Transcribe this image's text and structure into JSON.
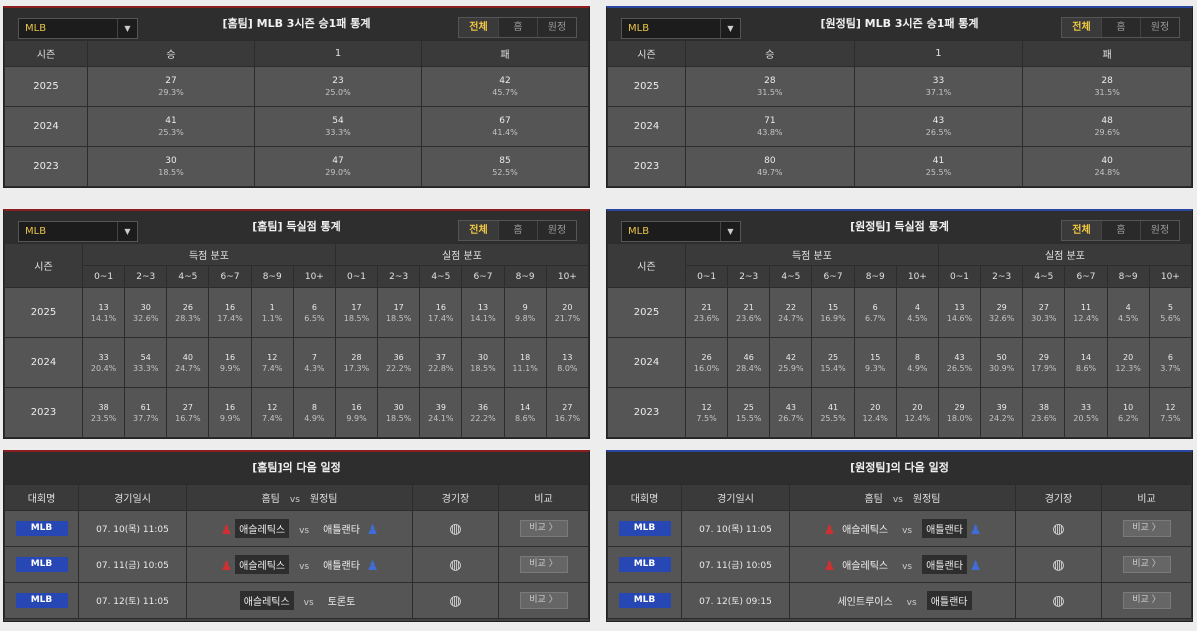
{
  "league_select": "MLB",
  "tabs": [
    "전체",
    "홈",
    "원정"
  ],
  "wdl_headers": [
    "시즌",
    "승",
    "1",
    "패"
  ],
  "home_wdl": {
    "title": "[홈팀] MLB 3시즌 승1패 통계",
    "rows": [
      {
        "season": "2025",
        "w": "27",
        "wp": "29.3%",
        "d": "23",
        "dp": "25.0%",
        "l": "42",
        "lp": "45.7%"
      },
      {
        "season": "2024",
        "w": "41",
        "wp": "25.3%",
        "d": "54",
        "dp": "33.3%",
        "l": "67",
        "lp": "41.4%"
      },
      {
        "season": "2023",
        "w": "30",
        "wp": "18.5%",
        "d": "47",
        "dp": "29.0%",
        "l": "85",
        "lp": "52.5%"
      }
    ]
  },
  "away_wdl": {
    "title": "[원정팀] MLB 3시즌 승1패 통계",
    "rows": [
      {
        "season": "2025",
        "w": "28",
        "wp": "31.5%",
        "d": "33",
        "dp": "37.1%",
        "l": "28",
        "lp": "31.5%"
      },
      {
        "season": "2024",
        "w": "71",
        "wp": "43.8%",
        "d": "43",
        "dp": "26.5%",
        "l": "48",
        "lp": "29.6%"
      },
      {
        "season": "2023",
        "w": "80",
        "wp": "49.7%",
        "d": "41",
        "dp": "25.5%",
        "l": "40",
        "lp": "24.8%"
      }
    ]
  },
  "runs_headers": {
    "season": "시즌",
    "scored": "득점 분포",
    "allowed": "실점 분포",
    "ranges": [
      "0~1",
      "2~3",
      "4~5",
      "6~7",
      "8~9",
      "10+"
    ]
  },
  "home_runs": {
    "title": "[홈팀] 득실점 통계",
    "rows": [
      {
        "season": "2025",
        "cells": [
          [
            "13",
            "14.1%"
          ],
          [
            "30",
            "32.6%"
          ],
          [
            "26",
            "28.3%"
          ],
          [
            "16",
            "17.4%"
          ],
          [
            "1",
            "1.1%"
          ],
          [
            "6",
            "6.5%"
          ],
          [
            "17",
            "18.5%"
          ],
          [
            "17",
            "18.5%"
          ],
          [
            "16",
            "17.4%"
          ],
          [
            "13",
            "14.1%"
          ],
          [
            "9",
            "9.8%"
          ],
          [
            "20",
            "21.7%"
          ]
        ]
      },
      {
        "season": "2024",
        "cells": [
          [
            "33",
            "20.4%"
          ],
          [
            "54",
            "33.3%"
          ],
          [
            "40",
            "24.7%"
          ],
          [
            "16",
            "9.9%"
          ],
          [
            "12",
            "7.4%"
          ],
          [
            "7",
            "4.3%"
          ],
          [
            "28",
            "17.3%"
          ],
          [
            "36",
            "22.2%"
          ],
          [
            "37",
            "22.8%"
          ],
          [
            "30",
            "18.5%"
          ],
          [
            "18",
            "11.1%"
          ],
          [
            "13",
            "8.0%"
          ]
        ]
      },
      {
        "season": "2023",
        "cells": [
          [
            "38",
            "23.5%"
          ],
          [
            "61",
            "37.7%"
          ],
          [
            "27",
            "16.7%"
          ],
          [
            "16",
            "9.9%"
          ],
          [
            "12",
            "7.4%"
          ],
          [
            "8",
            "4.9%"
          ],
          [
            "16",
            "9.9%"
          ],
          [
            "30",
            "18.5%"
          ],
          [
            "39",
            "24.1%"
          ],
          [
            "36",
            "22.2%"
          ],
          [
            "14",
            "8.6%"
          ],
          [
            "27",
            "16.7%"
          ]
        ]
      }
    ]
  },
  "away_runs": {
    "title": "[원정팀] 득실점 통계",
    "rows": [
      {
        "season": "2025",
        "cells": [
          [
            "21",
            "23.6%"
          ],
          [
            "21",
            "23.6%"
          ],
          [
            "22",
            "24.7%"
          ],
          [
            "15",
            "16.9%"
          ],
          [
            "6",
            "6.7%"
          ],
          [
            "4",
            "4.5%"
          ],
          [
            "13",
            "14.6%"
          ],
          [
            "29",
            "32.6%"
          ],
          [
            "27",
            "30.3%"
          ],
          [
            "11",
            "12.4%"
          ],
          [
            "4",
            "4.5%"
          ],
          [
            "5",
            "5.6%"
          ]
        ]
      },
      {
        "season": "2024",
        "cells": [
          [
            "26",
            "16.0%"
          ],
          [
            "46",
            "28.4%"
          ],
          [
            "42",
            "25.9%"
          ],
          [
            "25",
            "15.4%"
          ],
          [
            "15",
            "9.3%"
          ],
          [
            "8",
            "4.9%"
          ],
          [
            "43",
            "26.5%"
          ],
          [
            "50",
            "30.9%"
          ],
          [
            "29",
            "17.9%"
          ],
          [
            "14",
            "8.6%"
          ],
          [
            "20",
            "12.3%"
          ],
          [
            "6",
            "3.7%"
          ]
        ]
      },
      {
        "season": "2023",
        "cells": [
          [
            "12",
            "7.5%"
          ],
          [
            "25",
            "15.5%"
          ],
          [
            "43",
            "26.7%"
          ],
          [
            "41",
            "25.5%"
          ],
          [
            "20",
            "12.4%"
          ],
          [
            "20",
            "12.4%"
          ],
          [
            "29",
            "18.0%"
          ],
          [
            "39",
            "24.2%"
          ],
          [
            "38",
            "23.6%"
          ],
          [
            "33",
            "20.5%"
          ],
          [
            "10",
            "6.2%"
          ],
          [
            "12",
            "7.5%"
          ]
        ]
      }
    ]
  },
  "sched_headers": {
    "league": "대회명",
    "date": "경기일시",
    "home": "홈팀",
    "vs": "vs",
    "away": "원정팀",
    "stadium": "경기장",
    "compare": "비교"
  },
  "compare_label": "비교 〉",
  "home_sched": {
    "title": "[홈팀]의 다음 일정",
    "rows": [
      {
        "league": "MLB",
        "date": "07. 10(목) 11:05",
        "home": "애슬레틱스",
        "home_hl": true,
        "home_icon": true,
        "away": "애틀랜타",
        "away_hl": false,
        "away_icon": true
      },
      {
        "league": "MLB",
        "date": "07. 11(금) 10:05",
        "home": "애슬레틱스",
        "home_hl": true,
        "home_icon": true,
        "away": "애틀랜타",
        "away_hl": false,
        "away_icon": true
      },
      {
        "league": "MLB",
        "date": "07. 12(토) 11:05",
        "home": "애슬레틱스",
        "home_hl": true,
        "home_icon": false,
        "away": "토론토",
        "away_hl": false,
        "away_icon": false
      }
    ]
  },
  "away_sched": {
    "title": "[원정팀]의 다음 일정",
    "rows": [
      {
        "league": "MLB",
        "date": "07. 10(목) 11:05",
        "home": "애슬레틱스",
        "home_hl": false,
        "home_icon": true,
        "away": "애틀랜타",
        "away_hl": true,
        "away_icon": true
      },
      {
        "league": "MLB",
        "date": "07. 11(금) 10:05",
        "home": "애슬레틱스",
        "home_hl": false,
        "home_icon": true,
        "away": "애틀랜타",
        "away_hl": true,
        "away_icon": true
      },
      {
        "league": "MLB",
        "date": "07. 12(토) 09:15",
        "home": "세인트루이스",
        "home_hl": false,
        "home_icon": false,
        "away": "애틀랜타",
        "away_hl": true,
        "away_icon": false
      }
    ]
  },
  "icons": {
    "home_team": "person-icon-red",
    "away_team": "person-icon-blue",
    "stadium": "stadium-icon",
    "dropdown": "chevron-down-icon"
  },
  "colors": {
    "home_accent": "#8b1e1e",
    "away_accent": "#2a47a0",
    "league_badge": "#2747b4",
    "active_tab": "#f0c845"
  }
}
